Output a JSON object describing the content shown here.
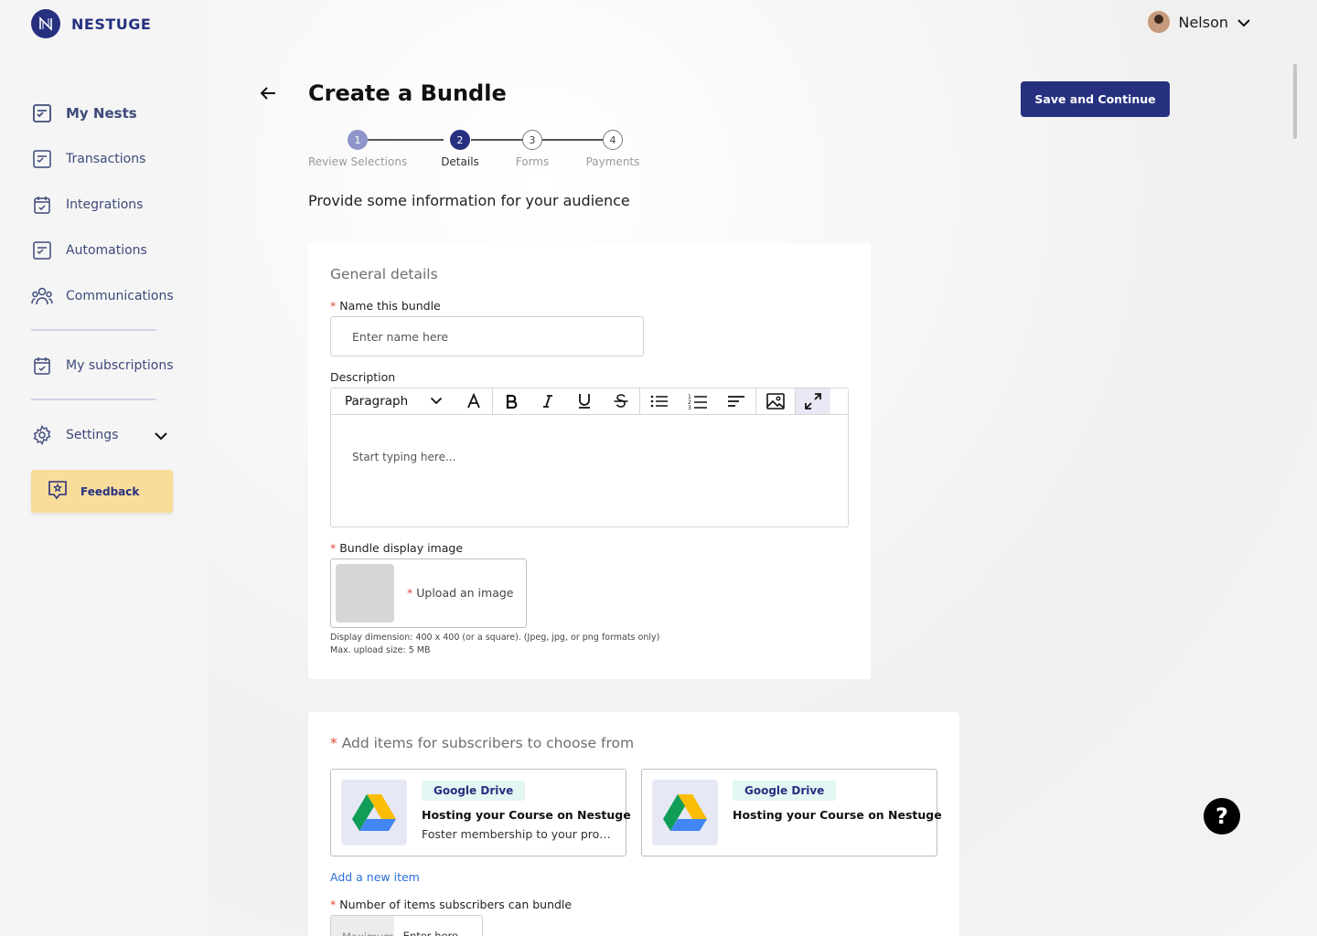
{
  "app": {
    "name": "NESTUGE"
  },
  "sidebar": {
    "items": [
      {
        "label": "My Nests",
        "icon": "checklist-icon"
      },
      {
        "label": "Transactions",
        "icon": "checklist-icon"
      },
      {
        "label": "Integrations",
        "icon": "calendar-check-icon"
      },
      {
        "label": "Automations",
        "icon": "checklist-icon"
      },
      {
        "label": "Communications",
        "icon": "group-icon"
      }
    ],
    "subscriptions": {
      "label": "My subscriptions",
      "icon": "calendar-check-icon"
    },
    "settings": {
      "label": "Settings",
      "icon": "gear-icon"
    },
    "feedback": {
      "label": "Feedback",
      "icon": "feedback-icon"
    }
  },
  "header": {
    "user_name": "Nelson"
  },
  "page": {
    "title": "Create a Bundle",
    "save_label": "Save and Continue",
    "subtitle": "Provide some information for your audience"
  },
  "stepper": {
    "steps": [
      {
        "number": "1",
        "label": "Review Selections",
        "state": "done"
      },
      {
        "number": "2",
        "label": "Details",
        "state": "current"
      },
      {
        "number": "3",
        "label": "Forms",
        "state": "upcoming"
      },
      {
        "number": "4",
        "label": "Payments",
        "state": "upcoming"
      }
    ]
  },
  "general": {
    "title": "General details",
    "name_label": "Name this bundle",
    "name_placeholder": "Enter name here",
    "description_label": "Description",
    "format_select": "Paragraph",
    "editor_placeholder": "Start typing here...",
    "image_label": "Bundle display image",
    "upload_text": "Upload an image",
    "hint_dimension": "Display dimension: 400 x 400 (or a square). (Jpeg, jpg, or png formats only)",
    "hint_size": "Max. upload size: 5 MB"
  },
  "items_section": {
    "title": "Add items for subscribers to choose from",
    "items": [
      {
        "badge": "Google Drive",
        "name": "Hosting your Course on Nestuge",
        "desc": "Foster membership to your profe..."
      },
      {
        "badge": "Google Drive",
        "name": "Hosting your Course on Nestuge",
        "desc": ""
      }
    ],
    "add_link": "Add a new item",
    "count_label": "Number of items subscribers can bundle",
    "count_prefix": "Maximum",
    "count_placeholder": "Enter here"
  },
  "help": {
    "label": "?"
  },
  "colors": {
    "brand": "#26307f",
    "feedback_bg": "#f8dc9a",
    "required": "#e0463b",
    "link": "#2a6fd6"
  }
}
